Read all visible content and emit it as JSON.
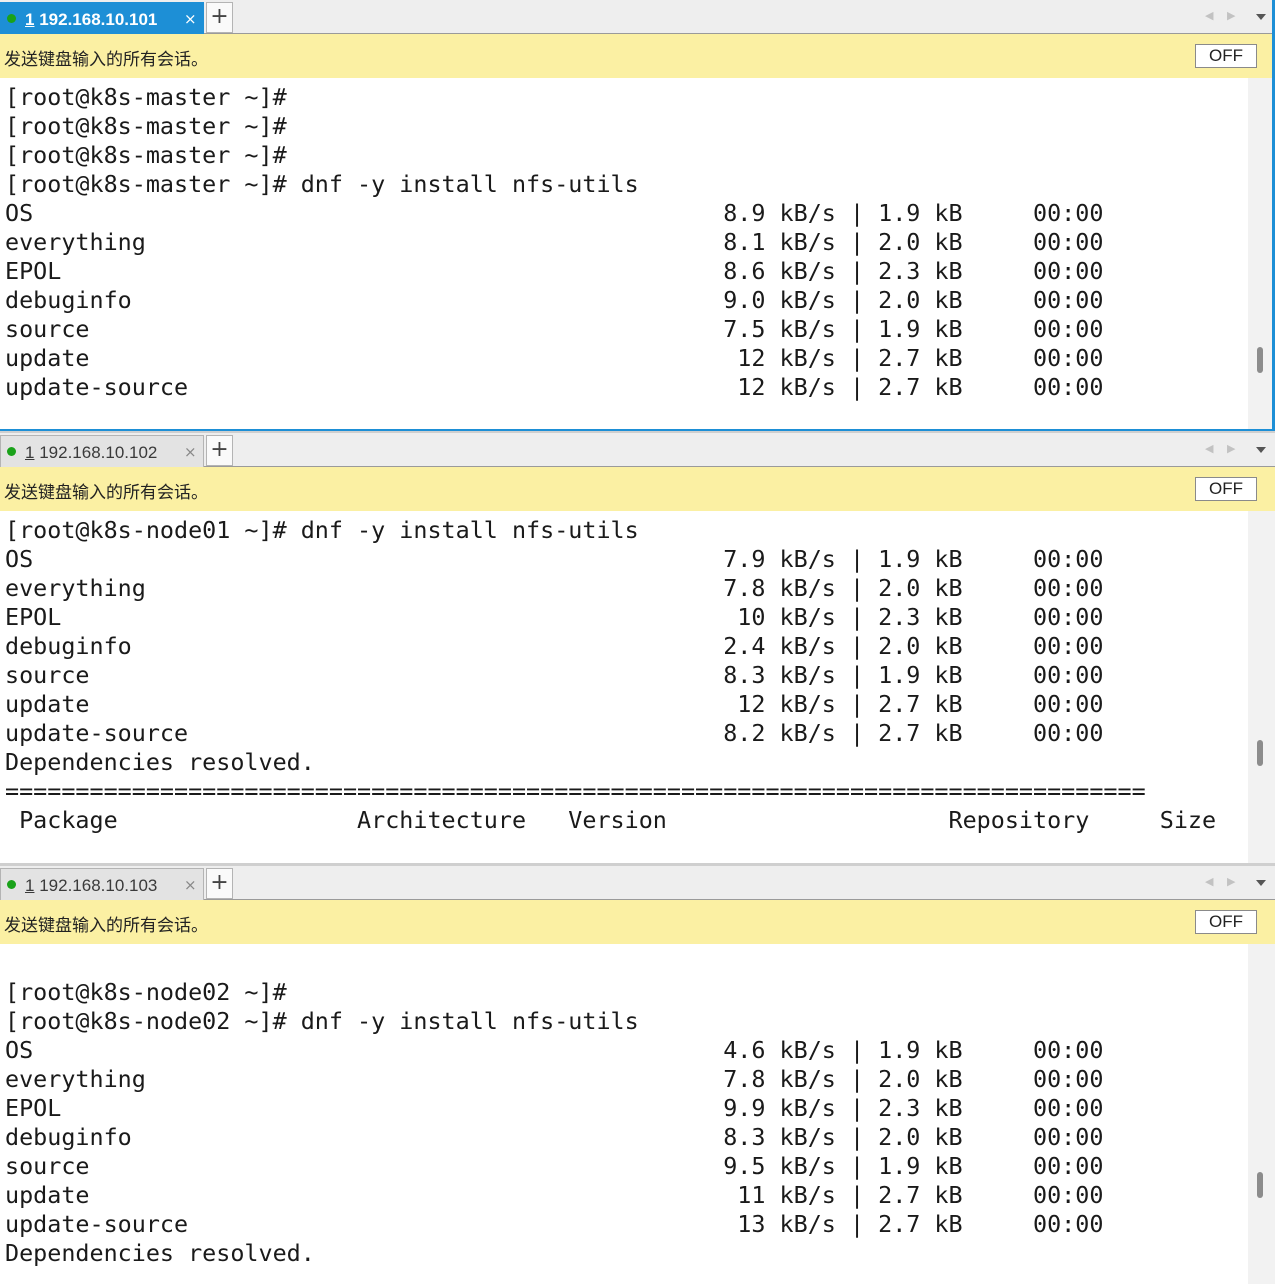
{
  "broadcast_text": "发送键盘输入的所有会话。",
  "broadcast_button": "OFF",
  "add_tab_symbol": "+",
  "close_symbol": "×",
  "panes": [
    {
      "tab_number": "1",
      "tab_host": "192.168.10.101",
      "active": true,
      "lines": [
        "[root@k8s-master ~]#",
        "[root@k8s-master ~]#",
        "[root@k8s-master ~]#",
        "[root@k8s-master ~]# dnf -y install nfs-utils",
        "OS                                                 8.9 kB/s | 1.9 kB     00:00",
        "everything                                         8.1 kB/s | 2.0 kB     00:00",
        "EPOL                                               8.6 kB/s | 2.3 kB     00:00",
        "debuginfo                                          9.0 kB/s | 2.0 kB     00:00",
        "source                                             7.5 kB/s | 1.9 kB     00:00",
        "update                                              12 kB/s | 2.7 kB     00:00",
        "update-source                                       12 kB/s | 2.7 kB     00:00"
      ]
    },
    {
      "tab_number": "1",
      "tab_host": "192.168.10.102",
      "active": false,
      "lines": [
        "[root@k8s-node01 ~]# dnf -y install nfs-utils",
        "OS                                                 7.9 kB/s | 1.9 kB     00:00",
        "everything                                         7.8 kB/s | 2.0 kB     00:00",
        "EPOL                                                10 kB/s | 2.3 kB     00:00",
        "debuginfo                                          2.4 kB/s | 2.0 kB     00:00",
        "source                                             8.3 kB/s | 1.9 kB     00:00",
        "update                                              12 kB/s | 2.7 kB     00:00",
        "update-source                                      8.2 kB/s | 2.7 kB     00:00",
        "Dependencies resolved.",
        "=================================================================================",
        " Package                 Architecture   Version                    Repository     Size"
      ]
    },
    {
      "tab_number": "1",
      "tab_host": "192.168.10.103",
      "active": false,
      "lines": [
        "",
        "[root@k8s-node02 ~]#",
        "[root@k8s-node02 ~]# dnf -y install nfs-utils",
        "OS                                                 4.6 kB/s | 1.9 kB     00:00",
        "everything                                         7.8 kB/s | 2.0 kB     00:00",
        "EPOL                                               9.9 kB/s | 2.3 kB     00:00",
        "debuginfo                                          8.3 kB/s | 2.0 kB     00:00",
        "source                                             9.5 kB/s | 1.9 kB     00:00",
        "update                                              11 kB/s | 2.7 kB     00:00",
        "update-source                                       13 kB/s | 2.7 kB     00:00",
        "Dependencies resolved."
      ]
    }
  ]
}
